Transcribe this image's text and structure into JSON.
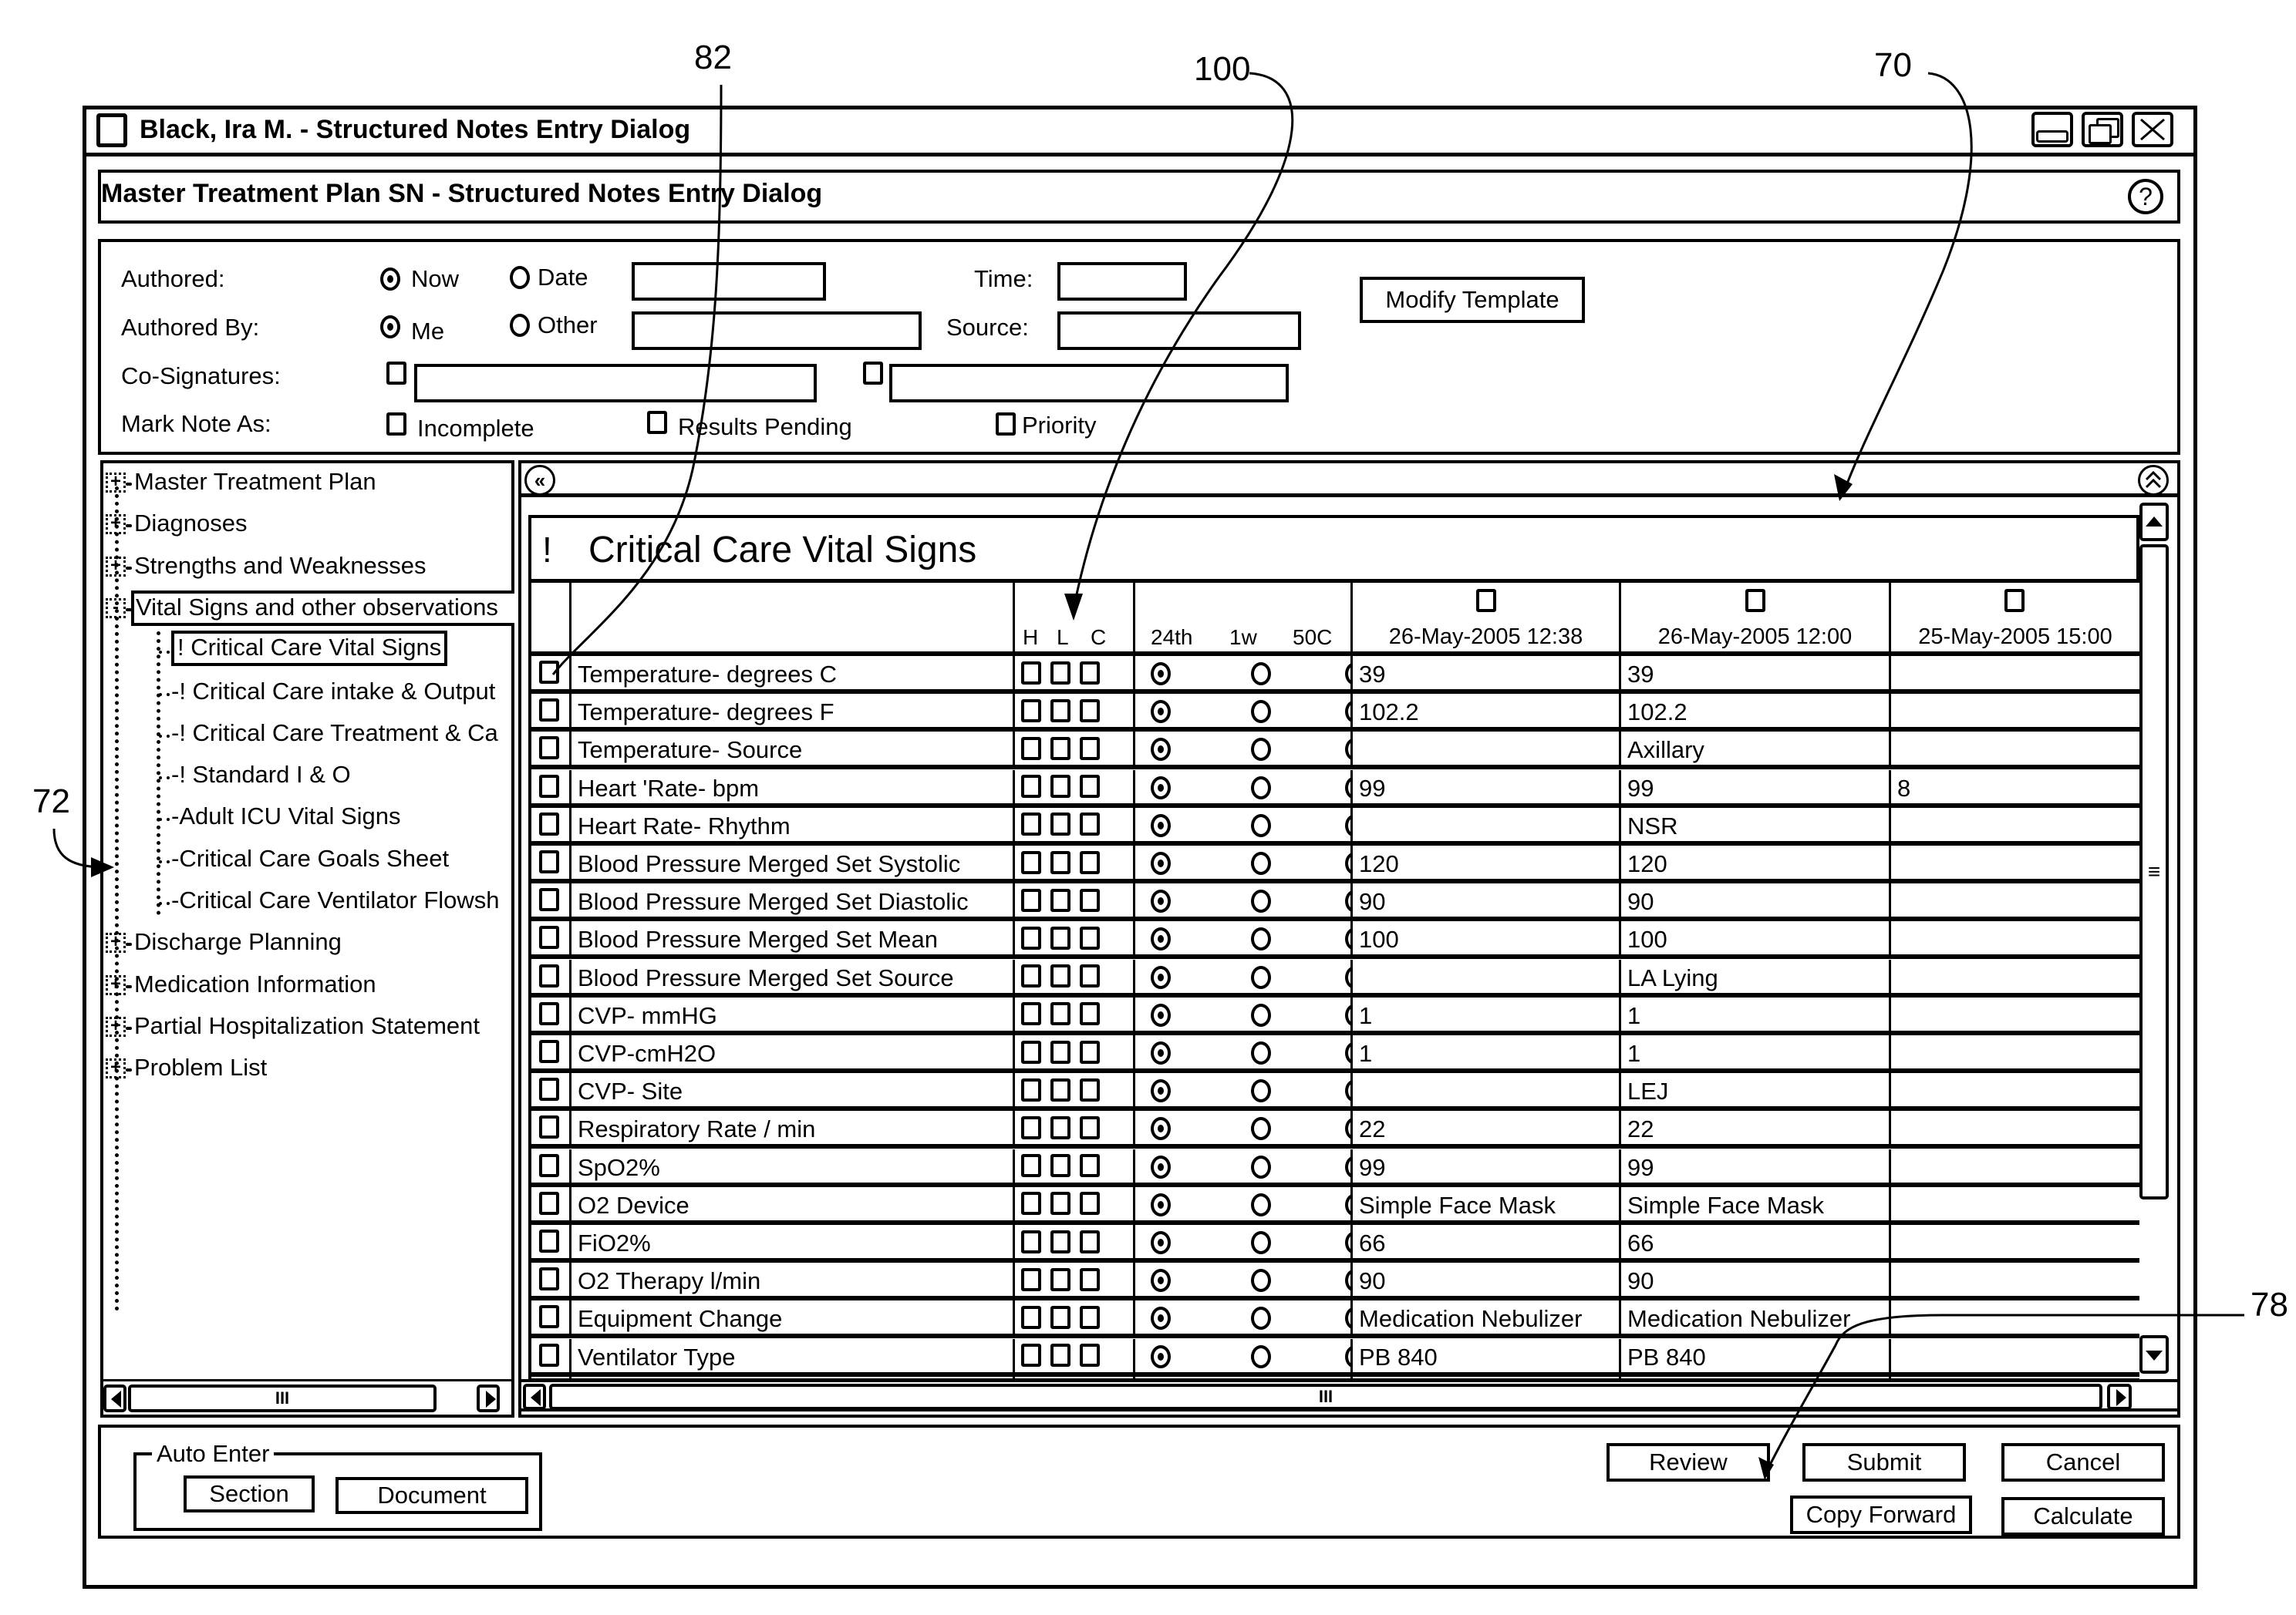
{
  "annotations": {
    "ref_82": "82",
    "ref_100": "100",
    "ref_70": "70",
    "ref_72": "72",
    "ref_78": "78"
  },
  "window": {
    "title": "Black, Ira M. - Structured Notes Entry Dialog",
    "controls": [
      "minimize",
      "restore",
      "close"
    ]
  },
  "subtitle_bar": {
    "title": "Master Treatment Plan SN - Structured Notes Entry Dialog",
    "help_icon": "?"
  },
  "form": {
    "authored": {
      "label": "Authored:",
      "options": [
        {
          "label": "Now",
          "selected": true
        },
        {
          "label": "Date",
          "selected": false
        }
      ],
      "date_value": "",
      "time_label": "Time:",
      "time_value": ""
    },
    "authored_by": {
      "label": "Authored By:",
      "options": [
        {
          "label": "Me",
          "selected": true
        },
        {
          "label": "Other",
          "selected": false
        }
      ],
      "other_value": "",
      "source_label": "Source:",
      "source_value": ""
    },
    "co_signatures": {
      "label": "Co-Signatures:",
      "fields": [
        {
          "checked": false,
          "value": ""
        },
        {
          "checked": false,
          "value": ""
        }
      ]
    },
    "mark_note_as": {
      "label": "Mark Note As:",
      "options": [
        {
          "label": "Incomplete",
          "checked": false
        },
        {
          "label": "Results Pending",
          "checked": false
        },
        {
          "label": "Priority",
          "checked": false
        }
      ]
    },
    "modify_template_label": "Modify Template"
  },
  "tree": {
    "items": [
      {
        "label": "Master Treatment Plan",
        "level": 0,
        "expander": "+"
      },
      {
        "label": "Diagnoses",
        "level": 0,
        "expander": "+"
      },
      {
        "label": "Strengths and Weaknesses",
        "level": 0,
        "expander": "+"
      },
      {
        "label": "Vital Signs and other observations",
        "level": 0,
        "expander": "-",
        "highlighted": true
      },
      {
        "label": "!  Critical Care Vital Signs",
        "level": 1,
        "selected": true
      },
      {
        "label": "! Critical Care intake & Output",
        "level": 1
      },
      {
        "label": "! Critical Care Treatment & Ca",
        "level": 1
      },
      {
        "label": "! Standard I & O",
        "level": 1
      },
      {
        "label": "Adult ICU Vital Signs",
        "level": 1
      },
      {
        "label": "Critical Care Goals Sheet",
        "level": 1
      },
      {
        "label": "Critical Care Ventilator Flowsh",
        "level": 1
      },
      {
        "label": "Discharge Planning",
        "level": 0,
        "expander": "+"
      },
      {
        "label": "Medication Information",
        "level": 0,
        "expander": "+"
      },
      {
        "label": "Partial Hospitalization Statement",
        "level": 0,
        "expander": "+"
      },
      {
        "label": "Problem List",
        "level": 0,
        "expander": "+"
      }
    ],
    "hscroll_thumb": "III"
  },
  "grid": {
    "collapse_left_icon": "«",
    "collapse_up_icon": "^",
    "section_marker": "!",
    "section_title": "Critical Care Vital Signs",
    "flag_headers": [
      "H",
      "L",
      "C"
    ],
    "range_headers": [
      "24th",
      "1w",
      "50C"
    ],
    "date_columns": [
      {
        "label": "26-May-2005 12:38",
        "checked": false
      },
      {
        "label": "26-May-2005 12:00",
        "checked": false
      },
      {
        "label": "25-May-2005  15:00",
        "checked": false
      }
    ],
    "rows": [
      {
        "label": "Temperature- degrees C",
        "selected_range": "24th",
        "values": [
          "39",
          "39",
          ""
        ]
      },
      {
        "label": "Temperature- degrees F",
        "selected_range": "24th",
        "values": [
          "102.2",
          "102.2",
          ""
        ]
      },
      {
        "label": "Temperature- Source",
        "selected_range": "24th",
        "values": [
          "",
          "Axillary",
          ""
        ]
      },
      {
        "label": "Heart 'Rate- bpm",
        "selected_range": "24th",
        "values": [
          "99",
          "99",
          "8"
        ]
      },
      {
        "label": "Heart Rate- Rhythm",
        "selected_range": "24th",
        "values": [
          "",
          "NSR",
          ""
        ]
      },
      {
        "label": "Blood Pressure Merged Set Systolic",
        "selected_range": "24th",
        "values": [
          "120",
          "120",
          ""
        ]
      },
      {
        "label": "Blood Pressure Merged Set Diastolic",
        "selected_range": "24th",
        "values": [
          "90",
          "90",
          ""
        ]
      },
      {
        "label": "Blood Pressure Merged Set Mean",
        "selected_range": "24th",
        "values": [
          "100",
          "100",
          ""
        ]
      },
      {
        "label": "Blood Pressure Merged Set Source",
        "selected_range": "24th",
        "values": [
          "",
          "LA Lying",
          ""
        ]
      },
      {
        "label": "CVP- mmHG",
        "selected_range": "24th",
        "values": [
          "1",
          "1",
          ""
        ]
      },
      {
        "label": "CVP-cmH2O",
        "selected_range": "24th",
        "values": [
          "1",
          "1",
          ""
        ]
      },
      {
        "label": "CVP- Site",
        "selected_range": "24th",
        "values": [
          "",
          "LEJ",
          ""
        ]
      },
      {
        "label": "Respiratory Rate / min",
        "selected_range": "24th",
        "values": [
          "22",
          "22",
          ""
        ]
      },
      {
        "label": "SpO2%",
        "selected_range": "24th",
        "values": [
          "99",
          "99",
          ""
        ]
      },
      {
        "label": "O2 Device",
        "selected_range": "24th",
        "values": [
          "Simple Face Mask",
          "Simple Face Mask",
          ""
        ]
      },
      {
        "label": "FiO2%",
        "selected_range": "24th",
        "values": [
          "66",
          "66",
          ""
        ]
      },
      {
        "label": "O2 Therapy l/min",
        "selected_range": "24th",
        "values": [
          "90",
          "90",
          ""
        ]
      },
      {
        "label": "Equipment Change",
        "selected_range": "24th",
        "values": [
          "Medication Nebulizer",
          "Medication Nebulizer",
          ""
        ]
      },
      {
        "label": "Ventilator Type",
        "selected_range": "24th",
        "values": [
          "PB 840",
          "PB 840",
          ""
        ]
      }
    ],
    "vscroll_grip": "≡",
    "hscroll_thumb": "III"
  },
  "footer": {
    "auto_enter": {
      "legend": "Auto Enter",
      "section_label": "Section",
      "document_label": "Document"
    },
    "buttons": {
      "review": "Review",
      "submit": "Submit",
      "cancel": "Cancel",
      "copy_forward": "Copy Forward",
      "calculate": "Calculate"
    }
  }
}
